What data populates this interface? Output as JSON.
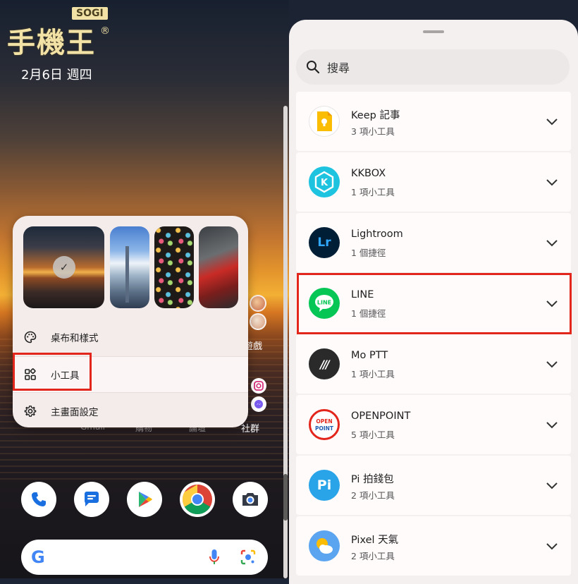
{
  "home": {
    "watermark": {
      "text": "手機王",
      "badge": "SOGI",
      "reg": "®"
    },
    "date": "2月6日 週四",
    "side_labels": {
      "games": "遊戲",
      "social": "社群"
    },
    "partial_labels": [
      "Gmail",
      "購物",
      "論壇"
    ],
    "popup": {
      "menu": [
        {
          "label": "桌布和樣式",
          "icon": "palette-icon"
        },
        {
          "label": "小工具",
          "icon": "widgets-icon"
        },
        {
          "label": "主畫面設定",
          "icon": "gear-icon"
        }
      ]
    },
    "dock": [
      "phone-icon",
      "messages-icon",
      "play-store-icon",
      "chrome-icon",
      "camera-icon"
    ],
    "google_bar": {
      "logo": "G"
    }
  },
  "picker": {
    "search_placeholder": "搜尋",
    "apps": [
      {
        "name": "Keep 記事",
        "sub": "3 項小工具"
      },
      {
        "name": "KKBOX",
        "sub": "1 項小工具"
      },
      {
        "name": "Lightroom",
        "sub": "1 個捷徑"
      },
      {
        "name": "LINE",
        "sub": "1 個捷徑"
      },
      {
        "name": "Mo PTT",
        "sub": "1 項小工具"
      },
      {
        "name": "OPENPOINT",
        "sub": "5 項小工具"
      },
      {
        "name": "Pi 拍錢包",
        "sub": "2 項小工具"
      },
      {
        "name": "Pixel 天氣",
        "sub": "2 項小工具"
      }
    ],
    "icon_text": {
      "lightroom": "Lr",
      "kkbox": "K",
      "line": "LINE",
      "mopt": "///",
      "open_top": "OPEN",
      "open_bottom": "POINT",
      "pi": "Pi"
    }
  },
  "colors": {
    "highlight": "#e3261b",
    "sheet": "#f5f0f0"
  }
}
